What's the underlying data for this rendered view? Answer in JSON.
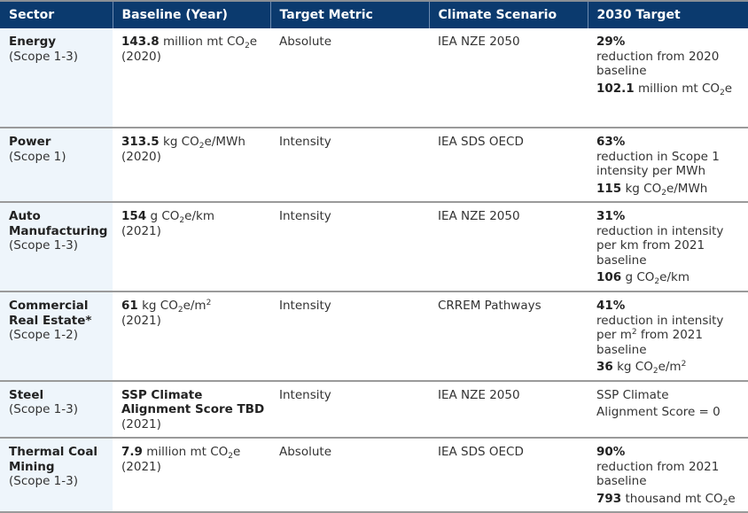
{
  "table": {
    "headers": [
      "Sector",
      "Baseline (Year)",
      "Target Metric",
      "Climate Scenario",
      "2030 Target"
    ],
    "header_color": "#0b3a6e",
    "sector_column_tint": "#eef5fb",
    "rows": [
      {
        "sector_name": "Energy",
        "sector_scope": "(Scope 1-3)",
        "baseline_value": "143.8",
        "baseline_unit_pre": "million mt CO",
        "baseline_unit_sub": "2",
        "baseline_unit_post": "e",
        "baseline_year": "(2020)",
        "target_metric": "Absolute",
        "climate_scenario": "IEA NZE 2050",
        "target_pct": "29%",
        "target_desc": "reduction from 2020 baseline",
        "target_value": "102.1",
        "target_unit_pre": "million mt CO",
        "target_unit_sub": "2",
        "target_unit_post": "e"
      },
      {
        "sector_name": "Power",
        "sector_scope": "(Scope 1)",
        "baseline_value": "313.5",
        "baseline_unit_pre": "kg CO",
        "baseline_unit_sub": "2",
        "baseline_unit_post": "e/MWh",
        "baseline_year": "(2020)",
        "target_metric": "Intensity",
        "climate_scenario": "IEA SDS OECD",
        "target_pct": "63%",
        "target_desc": "reduction in Scope 1 intensity per MWh",
        "target_value": "115",
        "target_unit_pre": "kg CO",
        "target_unit_sub": "2",
        "target_unit_post": "e/MWh"
      },
      {
        "sector_name": "Auto Manufacturing",
        "sector_scope": "(Scope 1-3)",
        "baseline_value": "154",
        "baseline_unit_pre": "g CO",
        "baseline_unit_sub": "2",
        "baseline_unit_post": "e/km",
        "baseline_year": "(2021)",
        "target_metric": "Intensity",
        "climate_scenario": "IEA NZE 2050",
        "target_pct": "31%",
        "target_desc": "reduction in intensity per km from 2021 baseline",
        "target_value": "106",
        "target_unit_pre": "g CO",
        "target_unit_sub": "2",
        "target_unit_post": "e/km"
      },
      {
        "sector_name": "Commercial Real Estate*",
        "sector_scope": "(Scope 1-2)",
        "baseline_value": "61",
        "baseline_unit_pre": "kg CO",
        "baseline_unit_sub": "2",
        "baseline_unit_post": "e/m",
        "baseline_unit_sup": "2",
        "baseline_year": "(2021)",
        "target_metric": "Intensity",
        "climate_scenario": "CRREM Pathways",
        "target_pct": "41%",
        "target_desc_pre": "reduction in intensity per m",
        "target_desc_sup": "2",
        "target_desc_post": " from 2021 baseline",
        "target_value": "36",
        "target_unit_pre": "kg CO",
        "target_unit_sub": "2",
        "target_unit_post": "e/m",
        "target_unit_sup": "2"
      },
      {
        "sector_name": "Steel",
        "sector_scope": "(Scope 1-3)",
        "baseline_bold_text": "SSP Climate Alignment Score TBD",
        "baseline_year": "(2021)",
        "target_metric": "Intensity",
        "climate_scenario": "IEA NZE 2050",
        "target_line1": "SSP Climate",
        "target_line2": "Alignment Score = 0"
      },
      {
        "sector_name": "Thermal Coal Mining",
        "sector_scope": "(Scope 1-3)",
        "baseline_value": "7.9",
        "baseline_unit_pre": "million mt CO",
        "baseline_unit_sub": "2",
        "baseline_unit_post": "e",
        "baseline_year": "(2021)",
        "target_metric": "Absolute",
        "climate_scenario": "IEA SDS OECD",
        "target_pct": "90%",
        "target_desc": "reduction from 2021 baseline",
        "target_value": "793",
        "target_unit_pre": "thousand mt CO",
        "target_unit_sub": "2",
        "target_unit_post": "e"
      }
    ]
  }
}
